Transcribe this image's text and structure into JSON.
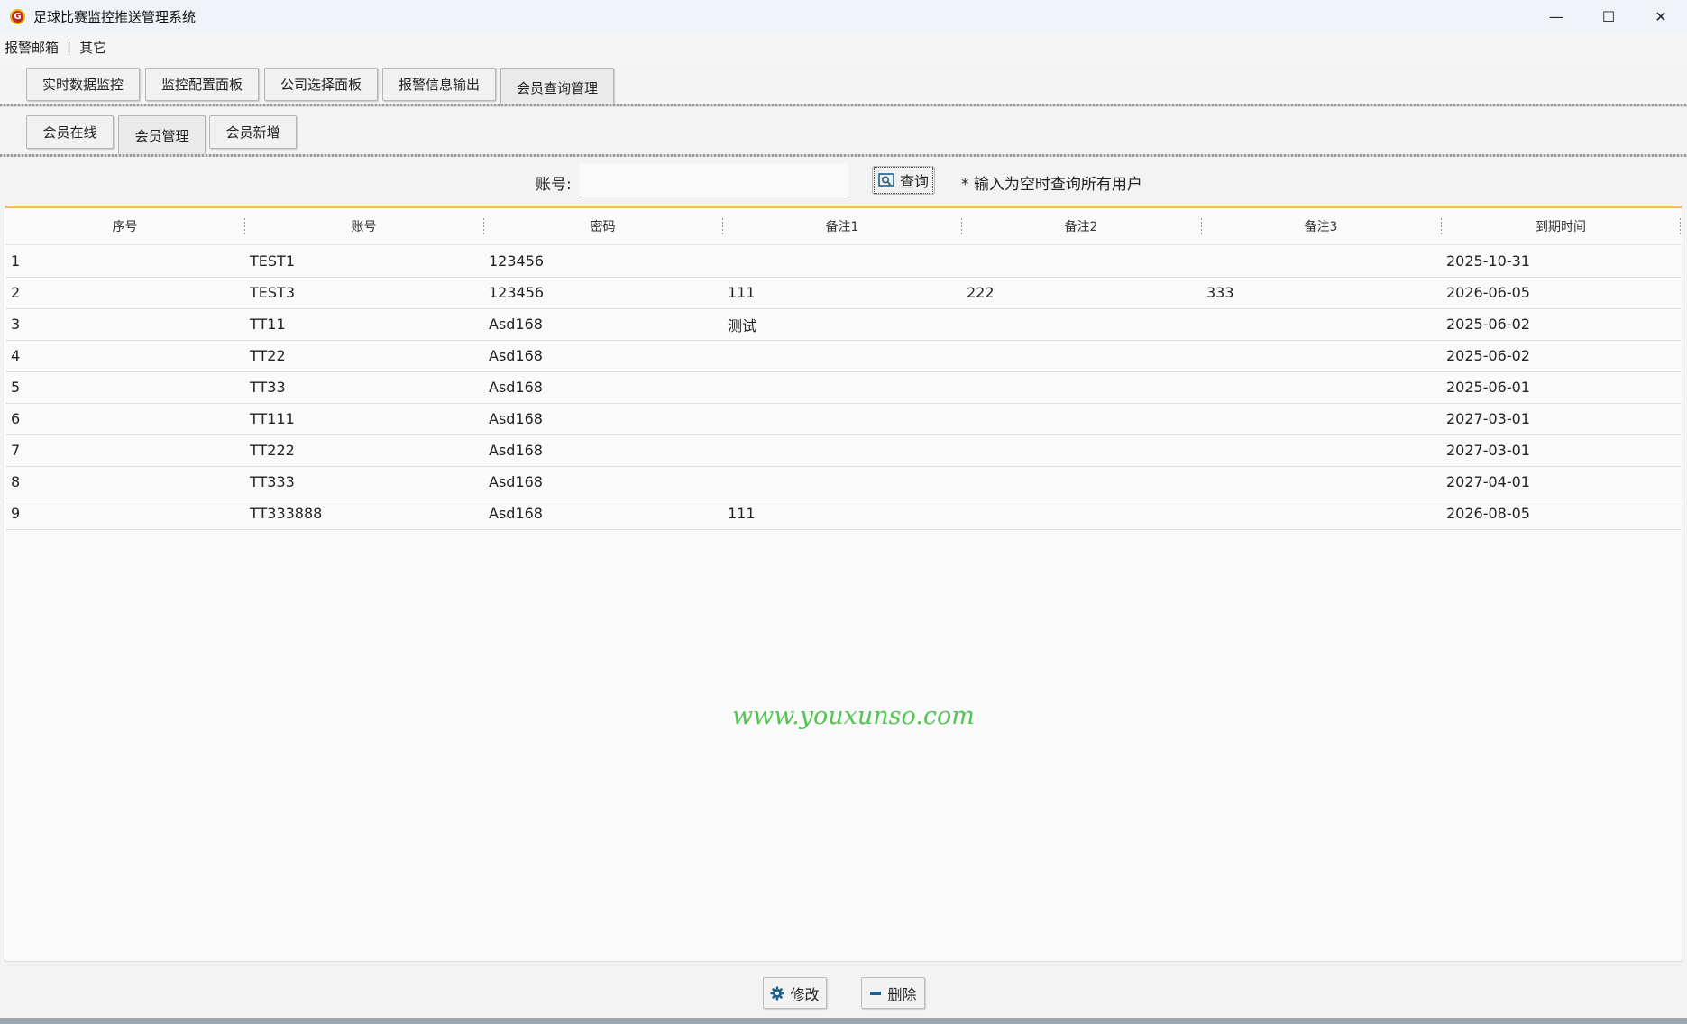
{
  "window": {
    "title": "足球比赛监控推送管理系统",
    "minimize": "—",
    "maximize": "☐",
    "close": "✕"
  },
  "menu": {
    "items": [
      "报警邮箱",
      "其它"
    ],
    "separator": "|"
  },
  "main_tabs": [
    "实时数据监控",
    "监控配置面板",
    "公司选择面板",
    "报警信息输出",
    "会员查询管理"
  ],
  "main_tab_active": "会员查询管理",
  "sub_tabs": [
    "会员在线",
    "会员管理",
    "会员新增"
  ],
  "sub_tab_active": "会员管理",
  "search": {
    "label": "账号:",
    "value": "",
    "placeholder": "",
    "button_label": "查询",
    "hint": "* 输入为空时查询所有用户"
  },
  "table": {
    "columns": [
      "序号",
      "账号",
      "密码",
      "备注1",
      "备注2",
      "备注3",
      "到期时间"
    ],
    "rows": [
      [
        "1",
        "TEST1",
        "123456",
        "",
        "",
        "",
        "2025-10-31"
      ],
      [
        "2",
        "TEST3",
        "123456",
        "111",
        "222",
        "333",
        "2026-06-05"
      ],
      [
        "3",
        "TT11",
        "Asd168",
        "测试",
        "",
        "",
        "2025-06-02"
      ],
      [
        "4",
        "TT22",
        "Asd168",
        "",
        "",
        "",
        "2025-06-02"
      ],
      [
        "5",
        "TT33",
        "Asd168",
        "",
        "",
        "",
        "2025-06-01"
      ],
      [
        "6",
        "TT111",
        "Asd168",
        "",
        "",
        "",
        "2027-03-01"
      ],
      [
        "7",
        "TT222",
        "Asd168",
        "",
        "",
        "",
        "2027-03-01"
      ],
      [
        "8",
        "TT333",
        "Asd168",
        "",
        "",
        "",
        "2027-04-01"
      ],
      [
        "9",
        "TT333888",
        "Asd168",
        "111",
        "",
        "",
        "2026-08-05"
      ]
    ]
  },
  "watermark": "www.youxunso.com",
  "actions": {
    "edit_label": "修改",
    "delete_label": "删除"
  },
  "colors": {
    "accent_line": "#f1b96c",
    "watermark": "#3fbf3f",
    "icon_blue": "#1f5f8b"
  }
}
